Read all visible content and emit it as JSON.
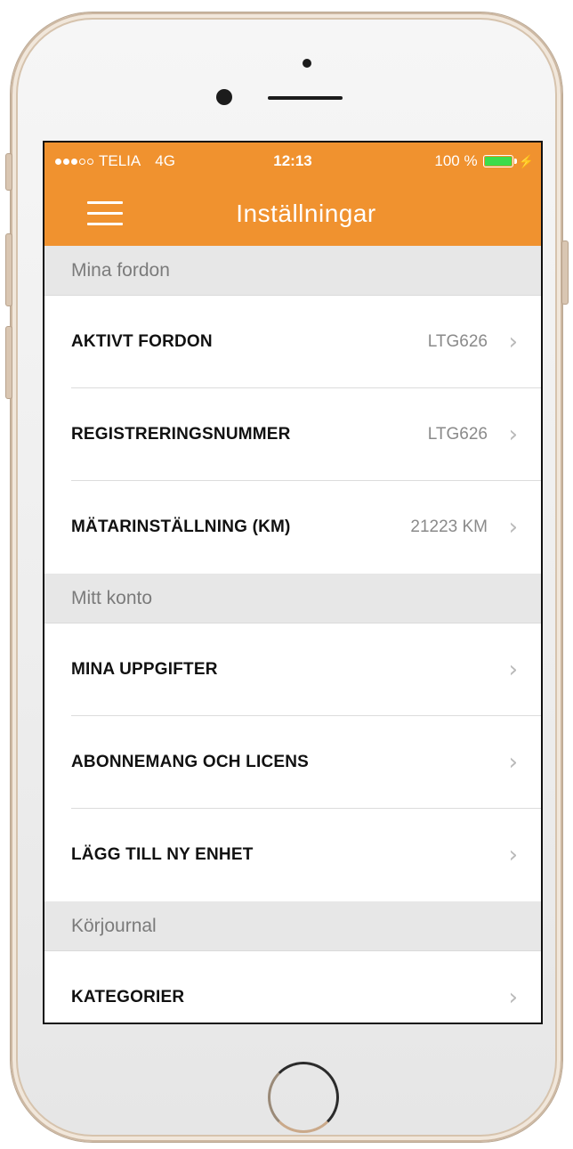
{
  "status_bar": {
    "carrier": "TELIA",
    "network": "4G",
    "time": "12:13",
    "battery": "100 %",
    "battery_level": 1.0,
    "signal_bars_filled": 3,
    "signal_bars_total": 5
  },
  "header": {
    "title": "Inställningar",
    "menu_icon": "hamburger-menu-icon"
  },
  "sections": [
    {
      "title": "Mina fordon",
      "items": [
        {
          "label": "AKTIVT FORDON",
          "value": "LTG626"
        },
        {
          "label": "REGISTRERINGSNUMMER",
          "value": "LTG626"
        },
        {
          "label": "MÄTARINSTÄLLNING (KM)",
          "value": "21223 KM"
        }
      ]
    },
    {
      "title": "Mitt konto",
      "items": [
        {
          "label": "MINA UPPGIFTER",
          "value": ""
        },
        {
          "label": "ABONNEMANG OCH LICENS",
          "value": ""
        },
        {
          "label": "LÄGG TILL NY ENHET",
          "value": ""
        }
      ]
    },
    {
      "title": "Körjournal",
      "items": [
        {
          "label": "KATEGORIER",
          "value": ""
        }
      ]
    }
  ],
  "colors": {
    "accent": "#f0922f",
    "section_bg": "#e7e7e7",
    "battery_green": "#3ddc4a"
  }
}
